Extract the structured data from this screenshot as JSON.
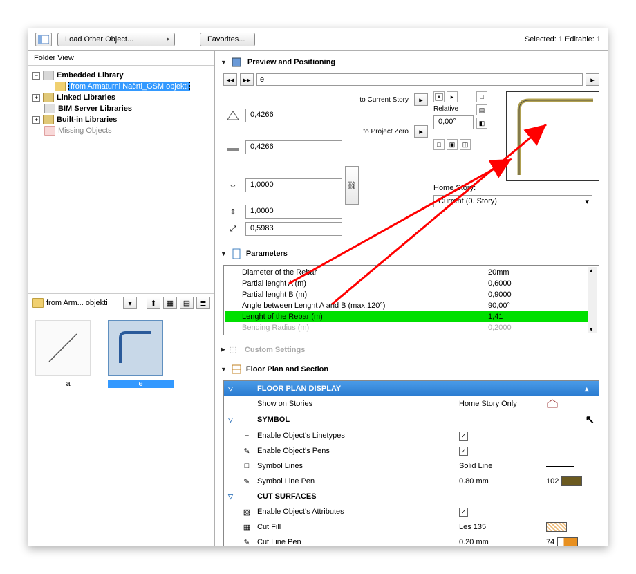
{
  "toolbar": {
    "load_label": "Load Other Object...",
    "favorites_label": "Favorites...",
    "status": "Selected: 1 Editable: 1"
  },
  "sidebar": {
    "folder_view": "Folder View",
    "tree": {
      "embedded": "Embedded Library",
      "selected_folder": "from Armaturni Načrti_GSM objekti",
      "linked": "Linked Libraries",
      "bim": "BIM Server Libraries",
      "builtin": "Built-in Libraries",
      "missing": "Missing Objects"
    },
    "path_label": "from Arm... objekti",
    "thumbs": {
      "a_label": "a",
      "b_label": "e"
    }
  },
  "preview": {
    "title": "Preview and Positioning",
    "name": "e",
    "to_current": "to Current Story",
    "to_zero": "to Project Zero",
    "relative": "Relative",
    "home_story": "Home Story:",
    "story_dd": "Current (0. Story)",
    "fields": {
      "z1": "0,4266",
      "z2": "0,4266",
      "w": "1,0000",
      "h": "1,0000",
      "len": "0,5983",
      "angle": "0,00°"
    }
  },
  "params": {
    "title": "Parameters",
    "rows": [
      {
        "label": "Diameter of the Rebar",
        "val": "20mm"
      },
      {
        "label": "Partial lenght A (m)",
        "val": "0,6000"
      },
      {
        "label": "Partial lenght B (m)",
        "val": "0,9000"
      },
      {
        "label": "Angle between Lenght A and B (max.120°)",
        "val": "90,00°"
      },
      {
        "label": "Lenght of the Rebar (m)",
        "val": "1,41",
        "hl": true
      },
      {
        "label": "Bending Radius (m)",
        "val": "0,2000",
        "dim": true
      }
    ]
  },
  "custom": {
    "title": "Custom Settings"
  },
  "fps": {
    "title": "Floor Plan and Section",
    "header": "FLOOR PLAN DISPLAY",
    "show_on": "Show on Stories",
    "show_on_val": "Home Story Only",
    "symbol": "SYMBOL",
    "enable_lt": "Enable Object's Linetypes",
    "enable_pens": "Enable Object's Pens",
    "symbol_lines": "Symbol Lines",
    "symbol_lines_val": "Solid Line",
    "symbol_pen": "Symbol Line Pen",
    "symbol_pen_val": "0.80 mm",
    "symbol_pen_num": "102",
    "cut": "CUT SURFACES",
    "enable_attr": "Enable Object's Attributes",
    "cut_fill": "Cut Fill",
    "cut_fill_val": "Les 135",
    "cut_pen": "Cut Line Pen",
    "cut_pen_val": "0.20 mm",
    "cut_pen_num": "74"
  }
}
